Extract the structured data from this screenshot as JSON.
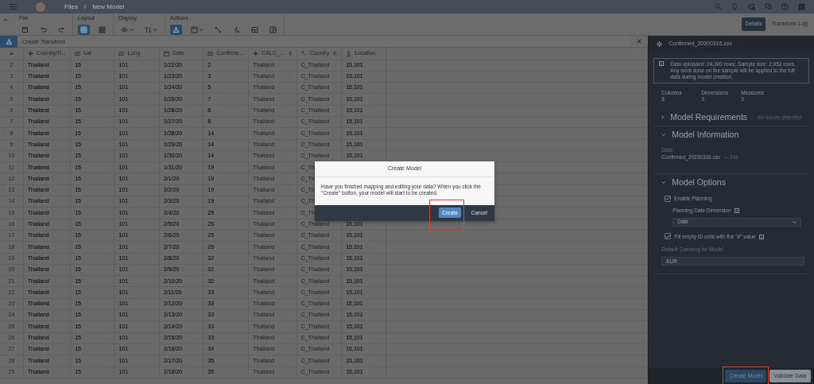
{
  "topbar": {
    "breadcrumb": [
      "Files",
      "New Model"
    ],
    "separator": "/"
  },
  "toolbar": {
    "groups": [
      {
        "label": "File",
        "tools": [
          {
            "selected": false
          },
          {
            "selected": false
          },
          {
            "selected": false
          }
        ]
      },
      {
        "label": "Layout",
        "tools": [
          {
            "selected": true
          },
          {
            "selected": false
          }
        ]
      },
      {
        "label": "Display",
        "tools": [
          {
            "selected": false
          },
          {
            "selected": false
          }
        ]
      },
      {
        "label": "Actions",
        "tools": [
          {
            "selected": true
          },
          {
            "selected": false
          },
          {
            "selected": false
          },
          {
            "selected": false
          },
          {
            "selected": false
          },
          {
            "selected": false
          }
        ]
      }
    ]
  },
  "view_tabs": [
    {
      "label": "Details",
      "selected": true
    },
    {
      "label": "Transform Log",
      "selected": false
    }
  ],
  "transform_bar": {
    "placeholder": "Create Transform"
  },
  "table": {
    "columns": [
      {
        "label": "Country/R...",
        "kind": "dimension",
        "calculated": false
      },
      {
        "label": "Lat",
        "kind": "measure",
        "calculated": false
      },
      {
        "label": "Long",
        "kind": "measure",
        "calculated": false
      },
      {
        "label": "Date",
        "kind": "date",
        "calculated": false
      },
      {
        "label": "Confirme...",
        "kind": "measure",
        "calculated": false
      },
      {
        "label": "CALC_...",
        "kind": "dimension",
        "calculated": true
      },
      {
        "label": "Country",
        "kind": "geo",
        "calculated": true
      },
      {
        "label": "Location",
        "kind": "location",
        "calculated": false
      }
    ],
    "rows": [
      {
        "number": "2",
        "cells": [
          "Thailand",
          "15",
          "101",
          "1/22/20",
          "2",
          "Thailand",
          "C_Thailand",
          "15,101"
        ]
      },
      {
        "number": "3",
        "cells": [
          "Thailand",
          "15",
          "101",
          "1/23/20",
          "3",
          "Thailand",
          "C_Thailand",
          "15,101"
        ]
      },
      {
        "number": "4",
        "cells": [
          "Thailand",
          "15",
          "101",
          "1/24/20",
          "5",
          "Thailand",
          "C_Thailand",
          "15,101"
        ]
      },
      {
        "number": "5",
        "cells": [
          "Thailand",
          "15",
          "101",
          "1/25/20",
          "7",
          "Thailand",
          "C_Thailand",
          "15,101"
        ]
      },
      {
        "number": "6",
        "cells": [
          "Thailand",
          "15",
          "101",
          "1/26/20",
          "8",
          "Thailand",
          "C_Thailand",
          "15,101"
        ]
      },
      {
        "number": "7",
        "cells": [
          "Thailand",
          "15",
          "101",
          "1/27/20",
          "8",
          "Thailand",
          "C_Thailand",
          "15,101"
        ]
      },
      {
        "number": "8",
        "cells": [
          "Thailand",
          "15",
          "101",
          "1/28/20",
          "14",
          "Thailand",
          "C_Thailand",
          "15,101"
        ]
      },
      {
        "number": "9",
        "cells": [
          "Thailand",
          "15",
          "101",
          "1/29/20",
          "14",
          "Thailand",
          "C_Thailand",
          "15,101"
        ]
      },
      {
        "number": "10",
        "cells": [
          "Thailand",
          "15",
          "101",
          "1/30/20",
          "14",
          "Thailand",
          "C_Thailand",
          "15,101"
        ]
      },
      {
        "number": "11",
        "cells": [
          "Thailand",
          "15",
          "101",
          "1/31/20",
          "19",
          "Thailand",
          "C_Th"
        ]
      },
      {
        "number": "12",
        "cells": [
          "Thailand",
          "15",
          "101",
          "2/1/20",
          "19",
          "Thailand",
          "C_Th"
        ]
      },
      {
        "number": "13",
        "cells": [
          "Thailand",
          "15",
          "101",
          "2/2/20",
          "19",
          "Thailand",
          "C_Th"
        ]
      },
      {
        "number": "14",
        "cells": [
          "Thailand",
          "15",
          "101",
          "2/3/20",
          "19",
          "Thailand",
          "C_Th"
        ]
      },
      {
        "number": "15",
        "cells": [
          "Thailand",
          "15",
          "101",
          "2/4/20",
          "25",
          "Thailand",
          "C_Th"
        ]
      },
      {
        "number": "16",
        "cells": [
          "Thailand",
          "15",
          "101",
          "2/5/20",
          "25",
          "Thailand",
          "C_Thailand",
          "15,101"
        ]
      },
      {
        "number": "17",
        "cells": [
          "Thailand",
          "15",
          "101",
          "2/6/20",
          "25",
          "Thailand",
          "C_Thailand",
          "15,101"
        ]
      },
      {
        "number": "18",
        "cells": [
          "Thailand",
          "15",
          "101",
          "2/7/20",
          "25",
          "Thailand",
          "C_Thailand",
          "15,101"
        ]
      },
      {
        "number": "19",
        "cells": [
          "Thailand",
          "15",
          "101",
          "2/8/20",
          "32",
          "Thailand",
          "C_Thailand",
          "15,101"
        ]
      },
      {
        "number": "20",
        "cells": [
          "Thailand",
          "15",
          "101",
          "2/9/20",
          "32",
          "Thailand",
          "C_Thailand",
          "15,101"
        ]
      },
      {
        "number": "21",
        "cells": [
          "Thailand",
          "15",
          "101",
          "2/10/20",
          "32",
          "Thailand",
          "C_Thailand",
          "15,101"
        ]
      },
      {
        "number": "22",
        "cells": [
          "Thailand",
          "15",
          "101",
          "2/11/20",
          "33",
          "Thailand",
          "C_Thailand",
          "15,101"
        ]
      },
      {
        "number": "23",
        "cells": [
          "Thailand",
          "15",
          "101",
          "2/12/20",
          "33",
          "Thailand",
          "C_Thailand",
          "15,101"
        ]
      },
      {
        "number": "24",
        "cells": [
          "Thailand",
          "15",
          "101",
          "2/13/20",
          "33",
          "Thailand",
          "C_Thailand",
          "15,101"
        ]
      },
      {
        "number": "25",
        "cells": [
          "Thailand",
          "15",
          "101",
          "2/14/20",
          "33",
          "Thailand",
          "C_Thailand",
          "15,101"
        ]
      },
      {
        "number": "26",
        "cells": [
          "Thailand",
          "15",
          "101",
          "2/15/20",
          "33",
          "Thailand",
          "C_Thailand",
          "15,101"
        ]
      },
      {
        "number": "27",
        "cells": [
          "Thailand",
          "15",
          "101",
          "2/16/20",
          "34",
          "Thailand",
          "C_Thailand",
          "15,101"
        ]
      },
      {
        "number": "28",
        "cells": [
          "Thailand",
          "15",
          "101",
          "2/17/20",
          "35",
          "Thailand",
          "C_Thailand",
          "15,101"
        ]
      },
      {
        "number": "29",
        "cells": [
          "Thailand",
          "15",
          "101",
          "2/18/20",
          "35",
          "Thailand",
          "C_Thailand",
          "15,101"
        ]
      }
    ]
  },
  "panel": {
    "file_name": "Confirmed_20200316.csv",
    "info": "Data uploaded: 24,300 rows; Sample size: 2,052 rows. Any work done on the sample will be applied to the full data during model creation.",
    "stats": [
      {
        "label": "Columns",
        "value": "8"
      },
      {
        "label": "Dimensions",
        "value": "3"
      },
      {
        "label": "Measures",
        "value": "3"
      }
    ],
    "requirements": {
      "title": "Model Requirements",
      "expanded": false,
      "status": "No issues detected"
    },
    "information": {
      "title": "Model Information",
      "expanded": true,
      "data_label": "Data",
      "data_value": "Confirmed_20200316.csv",
      "data_type": "— File"
    },
    "options": {
      "title": "Model Options",
      "expanded": true,
      "enable_planning": {
        "label": "Enable Planning",
        "checked": true
      },
      "planning_date": {
        "label": "Planning Date Dimension",
        "value": "Date"
      },
      "fill_empty": {
        "label": "Fill empty ID cells with the \"#\" value",
        "checked": true
      },
      "currency": {
        "label": "Default Currency for Model",
        "value": "EUR"
      }
    },
    "buttons": [
      {
        "label": "Create Model",
        "primary": true,
        "highlighted": true
      },
      {
        "label": "Validate Data",
        "primary": false,
        "highlighted": false
      }
    ]
  },
  "dialog": {
    "title": "Create Model",
    "message": "Have you finished mapping and editing your data? When you click the \"Create\" button, your model will start to be created.",
    "buttons": [
      {
        "label": "Create",
        "primary": true,
        "highlighted": true
      },
      {
        "label": "Cancel",
        "primary": false,
        "highlighted": false
      }
    ]
  }
}
